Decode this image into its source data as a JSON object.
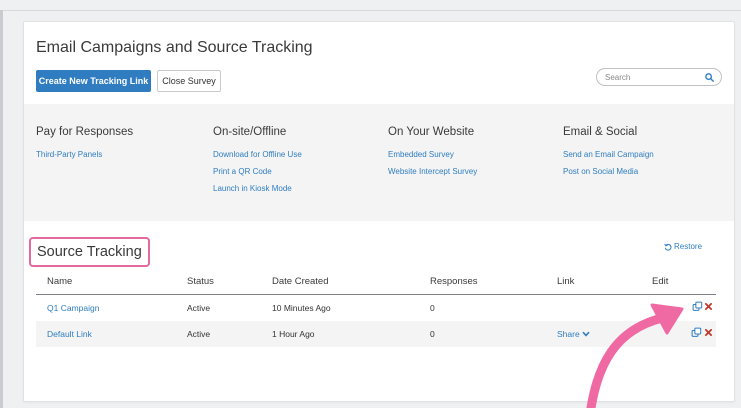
{
  "header": {
    "title": "Email Campaigns and Source Tracking",
    "create_link_label": "Create New Tracking Link",
    "close_survey_label": "Close Survey",
    "search_placeholder": "Search"
  },
  "distribution": [
    {
      "title": "Pay for Responses",
      "links": [
        "Third-Party Panels"
      ]
    },
    {
      "title": "On-site/Offline",
      "links": [
        "Download for Offline Use",
        "Print a QR Code",
        "Launch in Kiosk Mode"
      ]
    },
    {
      "title": "On Your Website",
      "links": [
        "Embedded Survey",
        "Website Intercept Survey"
      ]
    },
    {
      "title": "Email & Social",
      "links": [
        "Send an Email Campaign",
        "Post on Social Media"
      ]
    }
  ],
  "source_tracking": {
    "title": "Source Tracking",
    "restore_label": "Restore",
    "columns": [
      "Name",
      "Status",
      "Date Created",
      "Responses",
      "Link",
      "Edit"
    ],
    "rows": [
      {
        "name": "Q1 Campaign",
        "status": "Active",
        "date_created": "10 Minutes Ago",
        "responses": "0",
        "link": ""
      },
      {
        "name": "Default Link",
        "status": "Active",
        "date_created": "1 Hour Ago",
        "responses": "0",
        "link": "Share"
      }
    ]
  },
  "colors": {
    "accent": "#2f7dc0",
    "highlight": "#e36aa0",
    "delete": "#c0392b",
    "annotation_arrow": "#ef6aa3"
  },
  "icons": [
    "search-icon",
    "restore-icon",
    "chevron-down-icon",
    "copy-icon",
    "delete-icon"
  ]
}
